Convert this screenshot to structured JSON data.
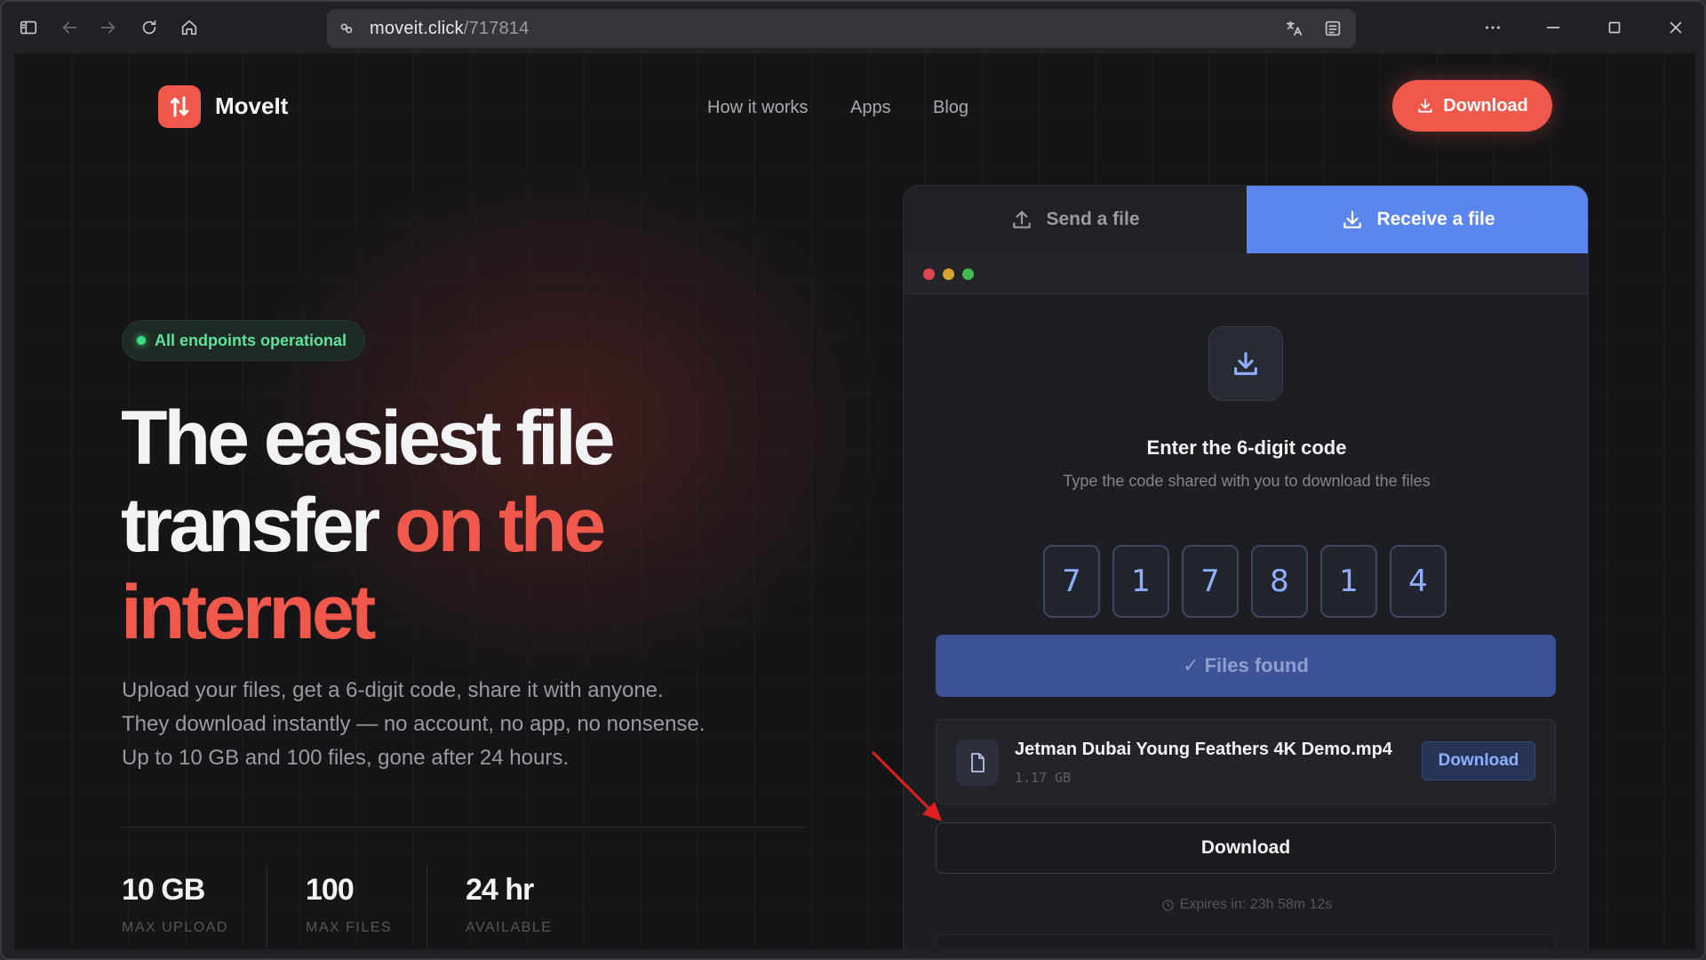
{
  "browser": {
    "url_host": "moveit.click",
    "url_path": "/717814"
  },
  "nav": {
    "brand": "MoveIt",
    "links": [
      "How it works",
      "Apps",
      "Blog"
    ],
    "download_label": "Download"
  },
  "hero": {
    "badge": "All endpoints operational",
    "headline_main": "The easiest file transfer ",
    "headline_accent": "on the internet",
    "subtitle": "Upload your files, get a 6-digit code, share it with anyone. They download instantly — no account, no app, no nonsense. Up to 10 GB and 100 files, gone after 24 hours.",
    "stats": [
      {
        "value": "10 GB",
        "label": "MAX UPLOAD"
      },
      {
        "value": "100",
        "label": "MAX FILES"
      },
      {
        "value": "24 hr",
        "label": "AVAILABLE"
      }
    ]
  },
  "panel": {
    "tabs": {
      "send": "Send a file",
      "receive": "Receive a file",
      "active": "receive"
    },
    "title": "Enter the 6-digit code",
    "subtitle": "Type the code shared with you to download the files",
    "code_digits": [
      "7",
      "1",
      "7",
      "8",
      "1",
      "4"
    ],
    "status": "✓ Files found",
    "file": {
      "name": "Jetman Dubai Young Feathers 4K Demo.mp4",
      "size": "1.17 GB",
      "download_label": "Download"
    },
    "download_all_label": "Download",
    "expires": "Expires in: 23h 58m 12s",
    "window_dots": [
      "#e0444e",
      "#d8a531",
      "#3fb950"
    ]
  },
  "colors": {
    "accent": "#f0584b",
    "primary": "#5b86f0",
    "success": "#3ddc84"
  }
}
